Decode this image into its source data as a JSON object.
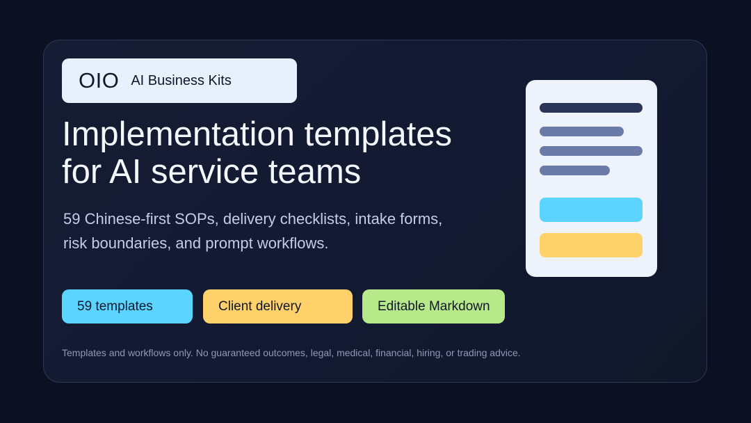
{
  "brand": {
    "logo": "OIO",
    "name": "AI Business Kits"
  },
  "headline": {
    "line1": "Implementation templates",
    "line2": "for AI service teams"
  },
  "subtext": {
    "line1": "59 Chinese-first SOPs, delivery checklists, intake forms,",
    "line2": "risk boundaries, and prompt workflows."
  },
  "pills": [
    {
      "label": "59 templates",
      "color": "#5bd5ff"
    },
    {
      "label": "Client delivery",
      "color": "#ffd16b"
    },
    {
      "label": "Editable Markdown",
      "color": "#b7e88a"
    }
  ],
  "footer": "Templates and workflows only. No guaranteed outcomes, legal, medical, financial, hiring, or trading advice.",
  "icon": "document-icon",
  "colors": {
    "background": "#0c1122",
    "card": "#151c33",
    "brand_bg": "#e8f0fe",
    "headline": "#f4f7fc",
    "subtext": "#c3cdea",
    "footer": "#8f9ab8"
  }
}
